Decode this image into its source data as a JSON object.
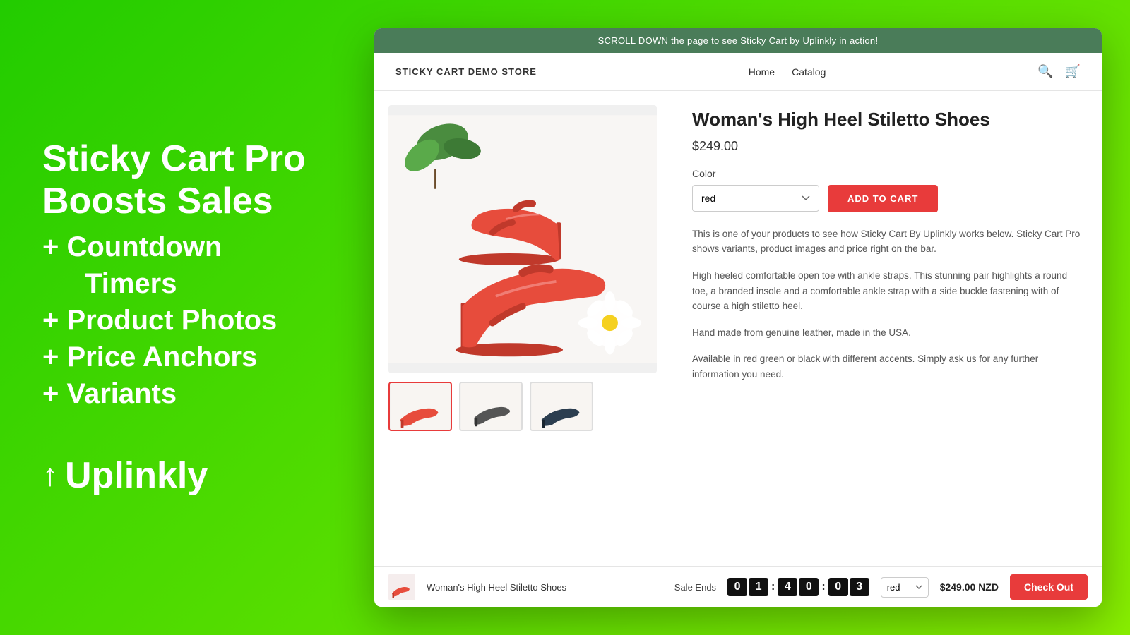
{
  "left": {
    "headline1": "Sticky Cart Pro",
    "headline2": "Boosts Sales",
    "features": [
      "+ Countdown",
      "Timers",
      "+ Product Photos",
      "+ Price Anchors",
      "+ Variants"
    ],
    "brand_name": "Uplinkly"
  },
  "store": {
    "announcement": "SCROLL DOWN the page to see Sticky Cart by Uplinkly in action!",
    "logo": "STICKY CART DEMO STORE",
    "nav": [
      "Home",
      "Catalog"
    ],
    "product": {
      "title": "Woman's High Heel Stiletto Shoes",
      "price": "$249.00",
      "color_label": "Color",
      "color_value": "red",
      "add_to_cart": "ADD TO CART",
      "desc1": "This is one of your products to see how Sticky Cart By Uplinkly works below.  Sticky Cart Pro shows variants, product images and price right on the bar.",
      "desc2": "High heeled comfortable open toe with ankle straps.  This stunning pair highlights a round toe, a branded insole and a comfortable ankle strap with a side buckle fastening with of course a high stiletto heel.",
      "desc3": "Hand made from genuine leather, made in the USA.",
      "desc4": "Available in red green or black with different accents.  Simply ask us for any further information you need."
    },
    "sticky_bar": {
      "product_name": "Woman's High Heel Stiletto Shoes",
      "sale_ends_label": "Sale Ends",
      "countdown": {
        "h1": "0",
        "h2": "1",
        "sep1": ":",
        "m1": "4",
        "m2": "0",
        "sep2": ":",
        "s1": "0",
        "s2": "3"
      },
      "color": "red",
      "price": "$249.00 NZD",
      "checkout": "Check Out"
    }
  }
}
